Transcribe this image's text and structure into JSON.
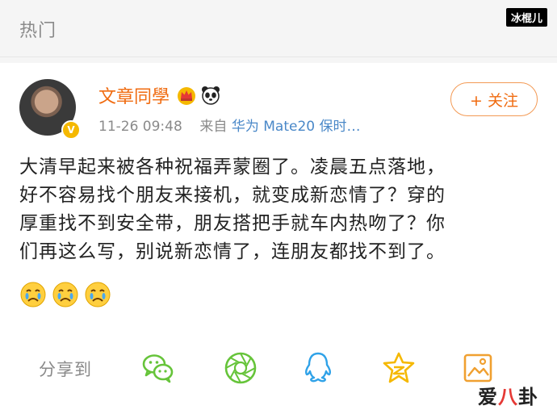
{
  "header": {
    "title": "热门"
  },
  "watermark_top": "冰棍儿",
  "post": {
    "username": "文章同學",
    "time": "11-26 09:48",
    "source_prefix": "来自",
    "device": "华为 Mate20 保时…",
    "follow_label": "+ 关注",
    "verified_badge": "V",
    "text_lines": [
      "大清早起来被各种祝福弄蒙圈了。凌晨五点落地，",
      "好不容易找个朋友来接机，就变成新恋情了？穿的",
      "厚重找不到安全带，朋友搭把手就车内热吻了？你",
      "们再这么写，别说新恋情了，连朋友都找不到了。"
    ],
    "emojis": [
      "crying-face-icon",
      "crying-face-icon",
      "crying-face-icon"
    ]
  },
  "share": {
    "label": "分享到",
    "targets": [
      "wechat-icon",
      "moments-icon",
      "qq-icon",
      "qzone-icon",
      "image-icon"
    ]
  },
  "watermark_bottom": {
    "part1": "爱",
    "part2": "八",
    "part3": "卦"
  },
  "colors": {
    "accent": "#f06b10",
    "link": "#4a88c8",
    "muted": "#8a8a8a",
    "share_green": "#66c43a",
    "share_blue": "#2fa2e8",
    "share_yellow": "#f5b800"
  }
}
